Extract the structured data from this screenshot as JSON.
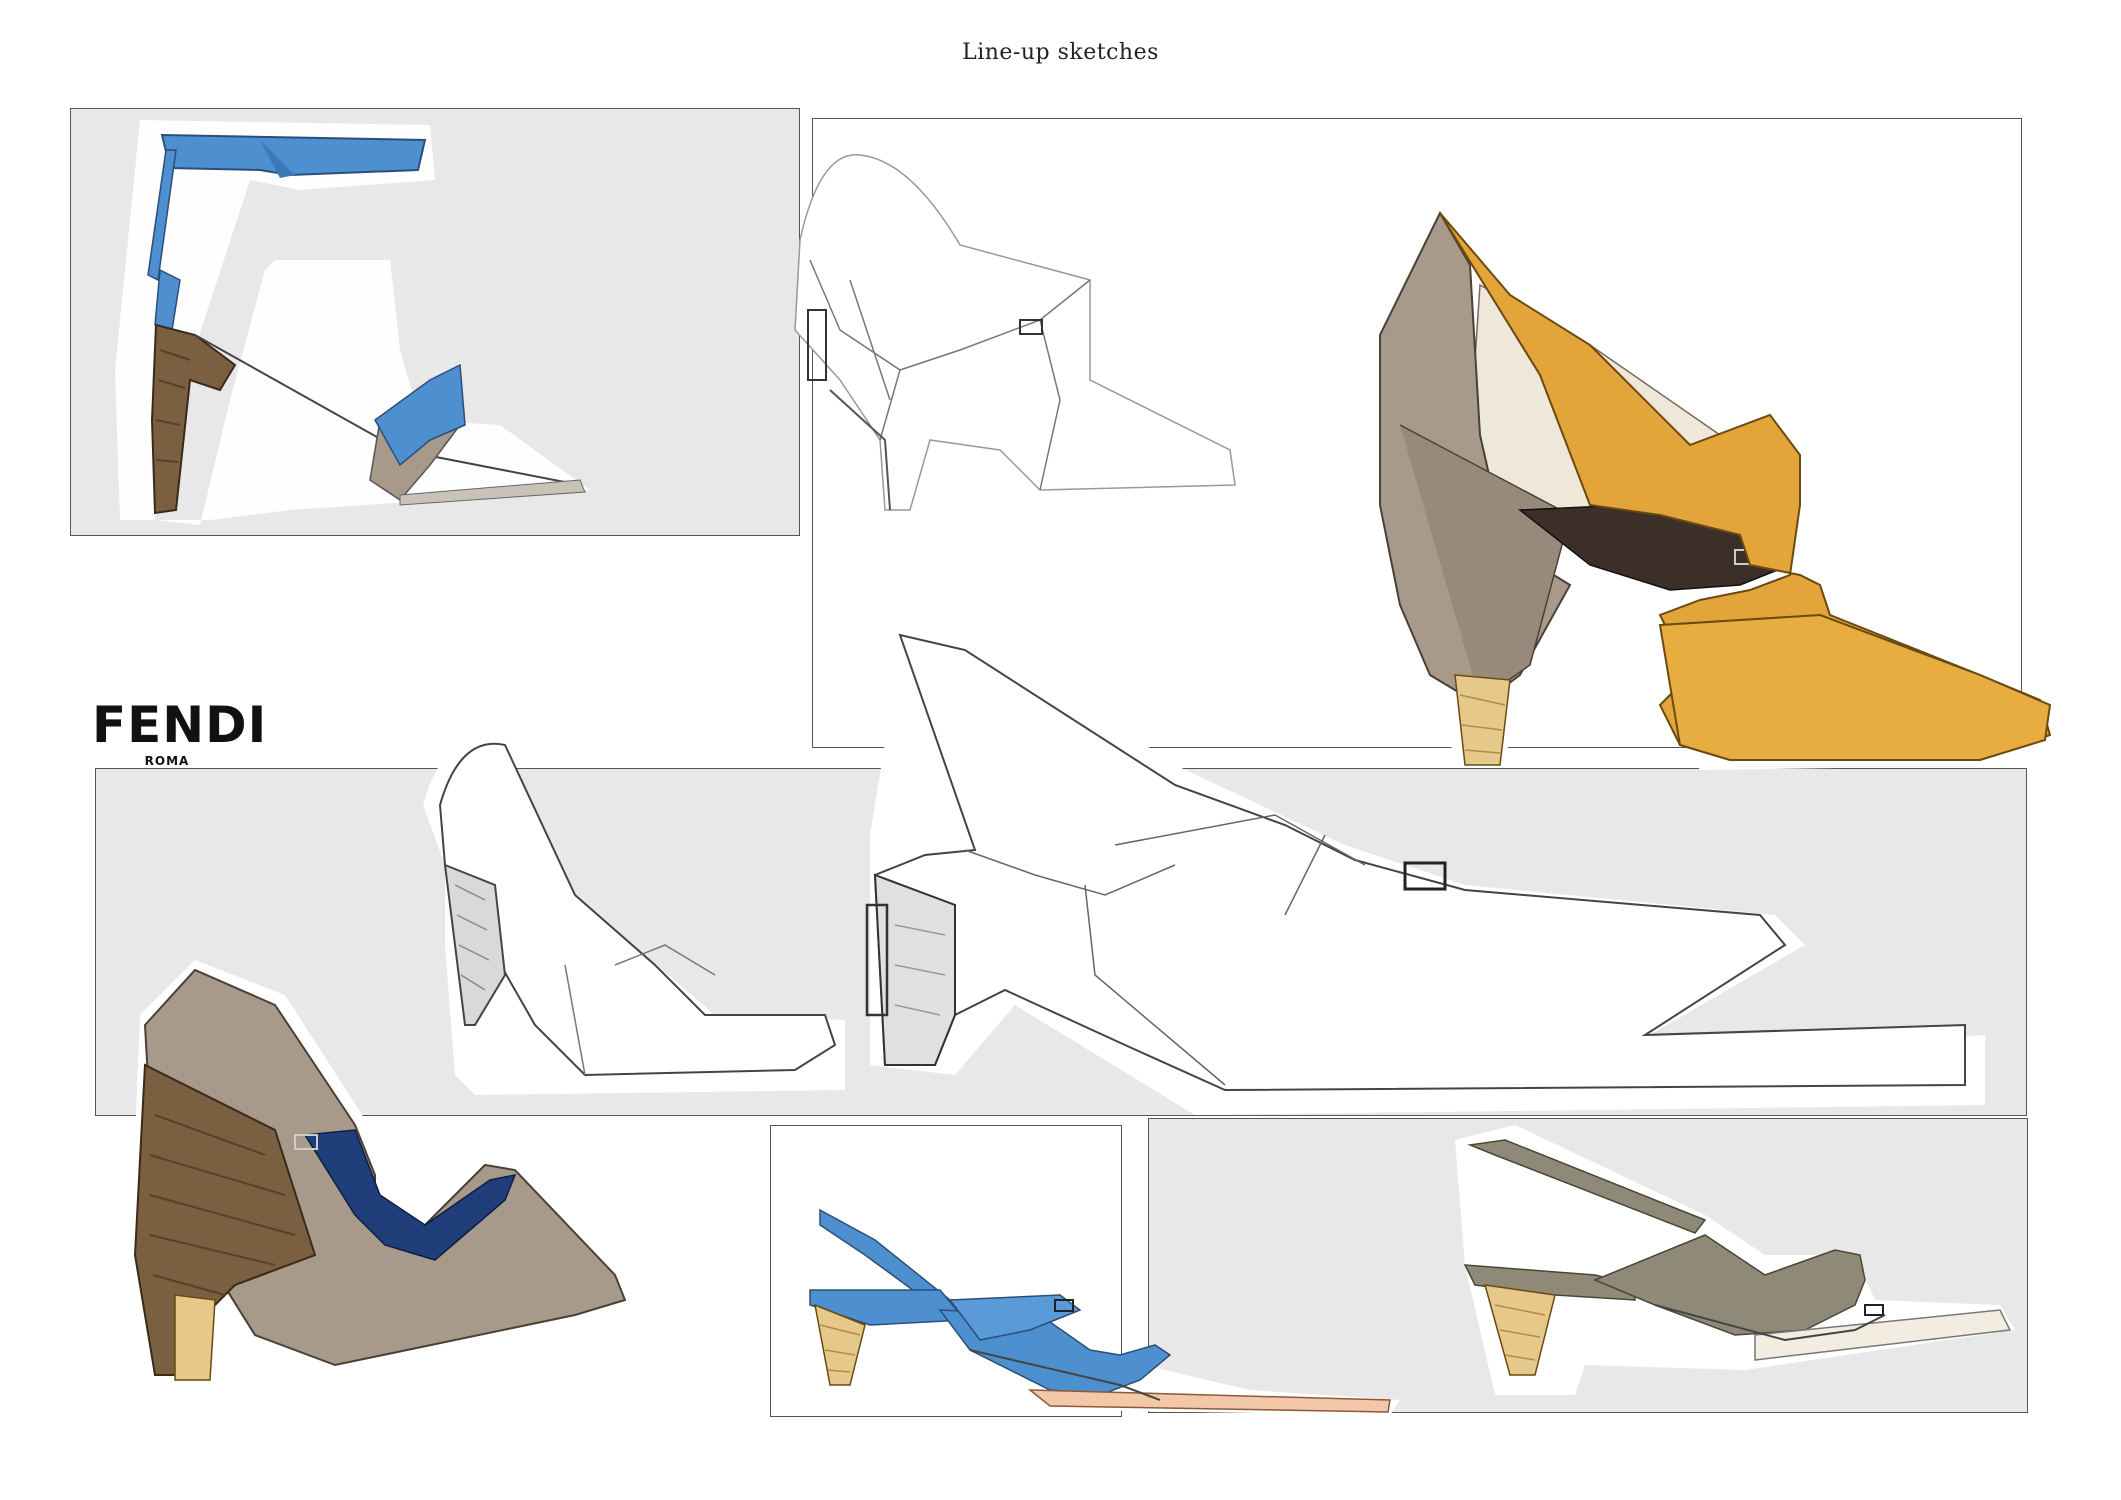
{
  "page": {
    "title": "Line-up sketches"
  },
  "brand": {
    "name": "FENDI",
    "subtitle": "ROMA"
  },
  "colors": {
    "panel_gray": "#e8e8e8",
    "blue": "#4e8fd0",
    "navy": "#1f3e7a",
    "taupe": "#a89a8a",
    "mustard": "#e3a53a",
    "wood": "#7a6040",
    "dark_brown": "#3b2f28",
    "olive_grey": "#8f8a78"
  },
  "sketches": [
    {
      "name": "blue ankle-strap sandal",
      "palette": [
        "blue",
        "taupe",
        "wood"
      ]
    },
    {
      "name": "white pencil bootie",
      "palette": [
        "white"
      ]
    },
    {
      "name": "mustard cut-out bootie",
      "palette": [
        "mustard",
        "taupe",
        "dark_brown"
      ]
    },
    {
      "name": "white pencil pump",
      "palette": [
        "white"
      ]
    },
    {
      "name": "white slingback",
      "palette": [
        "white"
      ]
    },
    {
      "name": "taupe and navy wedge pump",
      "palette": [
        "taupe",
        "navy",
        "wood"
      ]
    },
    {
      "name": "blue slingback",
      "palette": [
        "blue",
        "peach"
      ]
    },
    {
      "name": "grey slingback",
      "palette": [
        "olive_grey",
        "cream"
      ]
    }
  ]
}
